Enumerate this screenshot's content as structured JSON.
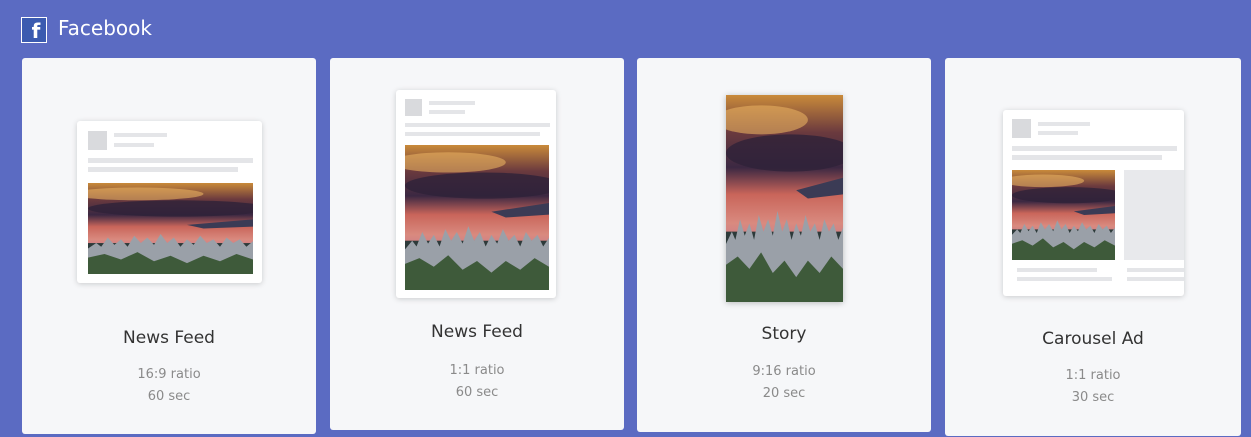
{
  "header": {
    "logo_glyph": "f",
    "title": "Facebook",
    "icon": "facebook-icon"
  },
  "cards": [
    {
      "title": "News Feed",
      "ratio": "16:9 ratio",
      "duration": "60 sec"
    },
    {
      "title": "News Feed",
      "ratio": "1:1 ratio",
      "duration": "60 sec"
    },
    {
      "title": "Story",
      "ratio": "9:16 ratio",
      "duration": "20 sec"
    },
    {
      "title": "Carousel Ad",
      "ratio": "1:1 ratio",
      "duration": "30 sec"
    }
  ],
  "colors": {
    "background": "#5b6bc2",
    "card": "#f6f7f9",
    "brand": "#3b5bb0"
  }
}
